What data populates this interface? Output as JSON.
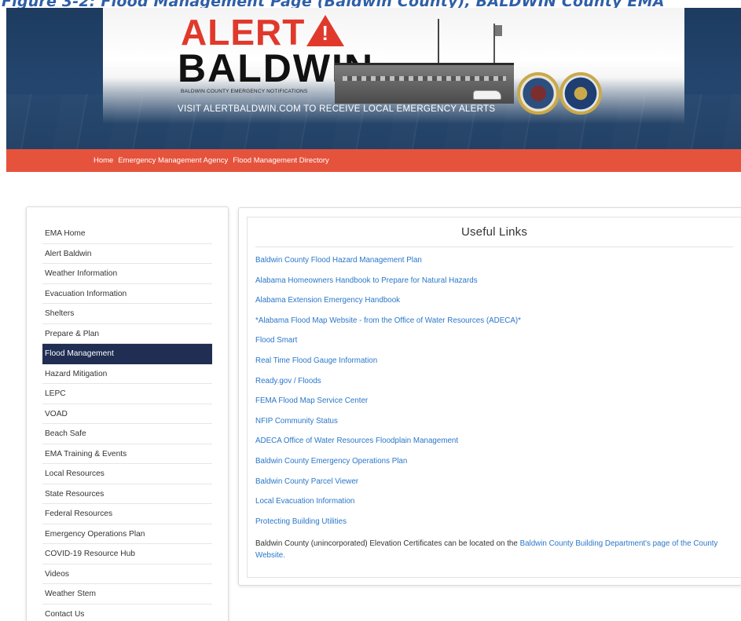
{
  "caption": "Figure 3-2: Flood Management Page (Baldwin County), BALDWIN County EMA",
  "banner": {
    "logo_alert": "ALERT",
    "logo_baldwin": "BALDWIN",
    "logo_sub": "BALDWIN COUNTY EMERGENCY NOTIFICATIONS",
    "visit_text": "VISIT ALERTBALDWIN.COM TO RECEIVE LOCAL EMERGENCY ALERTS",
    "icons": [
      "alert-triangle-icon",
      "county-seal-icon",
      "agency-seal-icon"
    ]
  },
  "nav": {
    "links": [
      "Home",
      "Emergency Management Agency",
      "Flood Management Directory"
    ]
  },
  "sidebar": {
    "items": [
      "EMA Home",
      "Alert Baldwin",
      "Weather Information",
      "Evacuation Information",
      "Shelters",
      "Prepare & Plan",
      "Flood Management",
      "Hazard Mitigation",
      "LEPC",
      "VOAD",
      "Beach Safe",
      "EMA Training & Events",
      "Local Resources",
      "State Resources",
      "Federal Resources",
      "Emergency Operations Plan",
      "COVID-19 Resource Hub",
      "Videos",
      "Weather Stem",
      "Contact Us"
    ],
    "active": "Flood Management"
  },
  "main": {
    "title": "Useful Links",
    "links": [
      "Baldwin County Flood Hazard Management Plan",
      "Alabama Homeowners Handbook to Prepare for Natural Hazards",
      "Alabama Extension Emergency Handbook",
      "*Alabama Flood Map Website - from the Office of Water Resources (ADECA)*",
      "Flood Smart",
      "Real Time Flood Gauge Information",
      "Ready.gov / Floods",
      "FEMA Flood Map Service Center",
      "NFIP Community Status",
      "ADECA Office of Water Resources Floodplain Management",
      "Baldwin County Emergency Operations Plan",
      "Baldwin County Parcel Viewer",
      "Local Evacuation Information",
      "Protecting Building Utilities"
    ],
    "note_text": "Baldwin County (unincorporated) Elevation Certificates can be located on the ",
    "note_link": "Baldwin County Building Department's page of the County Website."
  },
  "colors": {
    "nav_bar": "#e5533d",
    "banner_blue": "#1d3b5f",
    "active_item": "#1f2e52",
    "link": "#2a77c9",
    "alert_red": "#e0392b"
  }
}
